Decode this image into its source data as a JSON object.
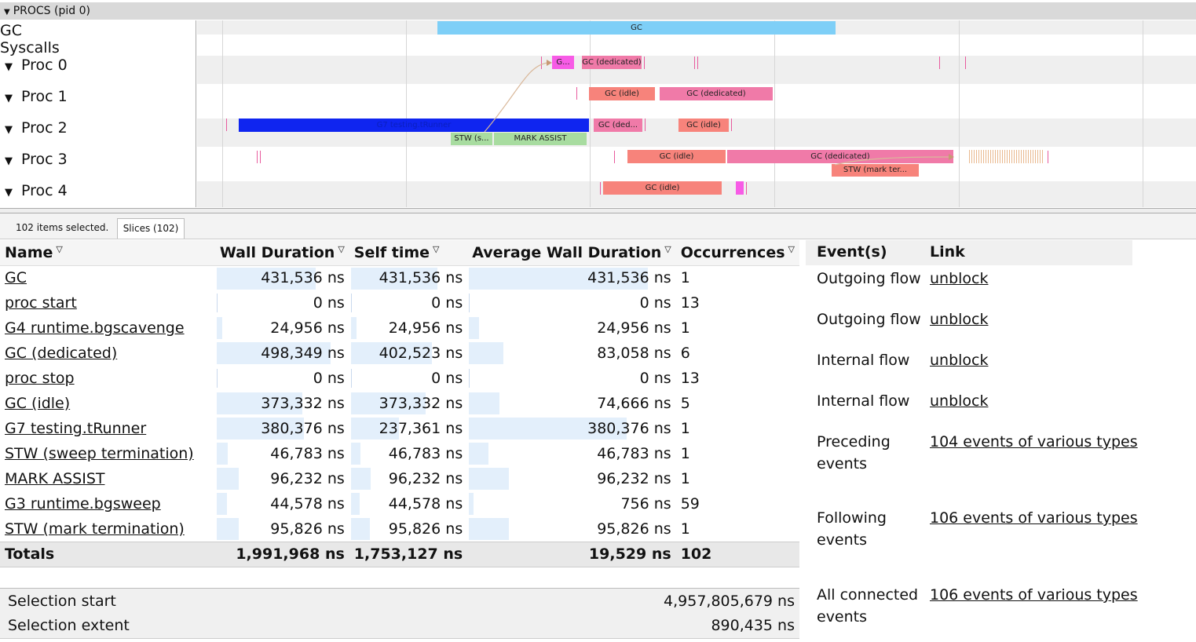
{
  "timeline": {
    "header": "PROCS (pid 0)",
    "tracks": [
      "GC",
      "Syscalls",
      "Proc 0",
      "Proc 1",
      "Proc 2",
      "Proc 3",
      "Proc 4"
    ],
    "slice_labels": {
      "gc": "GC",
      "g": "G...",
      "gc_dedicated": "GC (dedicated)",
      "gc_idle": "GC (idle)",
      "gc_ded_short": "GC (ded...",
      "g7": "G7 testing.tRunner",
      "stw_s": "STW (s...",
      "mark_assist": "MARK ASSIST",
      "stw_mark": "STW (mark ter..."
    }
  },
  "selection_bar": {
    "count_text": "102 items selected.",
    "tab_label": "Slices (102)"
  },
  "stats_table": {
    "headers": {
      "name": "Name",
      "wall": "Wall Duration",
      "self": "Self time",
      "avg": "Average Wall Duration",
      "occ": "Occurrences"
    },
    "rows": [
      {
        "name": "GC",
        "wall": "431,536",
        "self": "431,536",
        "avg": "431,536",
        "occ": "1",
        "wall_frac": 0.866,
        "self_frac": 1.0,
        "avg_frac": 1.0
      },
      {
        "name": "proc start",
        "wall": "0",
        "self": "0",
        "avg": "0",
        "occ": "13",
        "wall_frac": 0.0,
        "self_frac": 0.0,
        "avg_frac": 0.0
      },
      {
        "name": "G4 runtime.bgscavenge",
        "wall": "24,956",
        "self": "24,956",
        "avg": "24,956",
        "occ": "1",
        "wall_frac": 0.05,
        "self_frac": 0.062,
        "avg_frac": 0.058
      },
      {
        "name": "GC (dedicated)",
        "wall": "498,349",
        "self": "402,523",
        "avg": "83,058",
        "occ": "6",
        "wall_frac": 1.0,
        "self_frac": 0.933,
        "avg_frac": 0.192
      },
      {
        "name": "proc stop",
        "wall": "0",
        "self": "0",
        "avg": "0",
        "occ": "13",
        "wall_frac": 0.0,
        "self_frac": 0.0,
        "avg_frac": 0.0
      },
      {
        "name": "GC (idle)",
        "wall": "373,332",
        "self": "373,332",
        "avg": "74,666",
        "occ": "5",
        "wall_frac": 0.749,
        "self_frac": 0.865,
        "avg_frac": 0.173
      },
      {
        "name": "G7 testing.tRunner",
        "wall": "380,376",
        "self": "237,361",
        "avg": "380,376",
        "occ": "1",
        "wall_frac": 0.763,
        "self_frac": 0.55,
        "avg_frac": 0.881
      },
      {
        "name": "STW (sweep termination)",
        "wall": "46,783",
        "self": "46,783",
        "avg": "46,783",
        "occ": "1",
        "wall_frac": 0.094,
        "self_frac": 0.108,
        "avg_frac": 0.108
      },
      {
        "name": "MARK ASSIST",
        "wall": "96,232",
        "self": "96,232",
        "avg": "96,232",
        "occ": "1",
        "wall_frac": 0.193,
        "self_frac": 0.223,
        "avg_frac": 0.223
      },
      {
        "name": "G3 runtime.bgsweep",
        "wall": "44,578",
        "self": "44,578",
        "avg": "756",
        "occ": "59",
        "wall_frac": 0.089,
        "self_frac": 0.103,
        "avg_frac": 0.002
      },
      {
        "name": "STW (mark termination)",
        "wall": "95,826",
        "self": "95,826",
        "avg": "95,826",
        "occ": "1",
        "wall_frac": 0.192,
        "self_frac": 0.222,
        "avg_frac": 0.222
      }
    ],
    "unit": "ns",
    "totals": {
      "label": "Totals",
      "wall": "1,991,968",
      "self": "1,753,127",
      "avg": "19,529",
      "occ": "102"
    }
  },
  "selection_info": {
    "start_label": "Selection start",
    "start_value": "4,957,805,679 ns",
    "extent_label": "Selection extent",
    "extent_value": "890,435 ns"
  },
  "events_panel": {
    "header_event": "Event(s)",
    "header_link": "Link",
    "rows": [
      {
        "event": "Outgoing flow",
        "link": "unblock"
      },
      {
        "event": "Outgoing flow",
        "link": "unblock"
      },
      {
        "event": "Internal flow",
        "link": "unblock"
      },
      {
        "event": "Internal flow",
        "link": "unblock"
      },
      {
        "event": "Preceding events",
        "link": "104 events of various types"
      },
      {
        "event": "Following events",
        "link": "106 events of various types"
      },
      {
        "event": "All connected events",
        "link": "106 events of various types"
      }
    ]
  },
  "colors": {
    "gc": "#7ecff7",
    "gc_dedicated": "#f07aa8",
    "gc_idle": "#f7837b",
    "g_short": "#f75be6",
    "g7": "#0f25f0",
    "stw": "#a8dca0",
    "row_alt": "#efefef"
  }
}
